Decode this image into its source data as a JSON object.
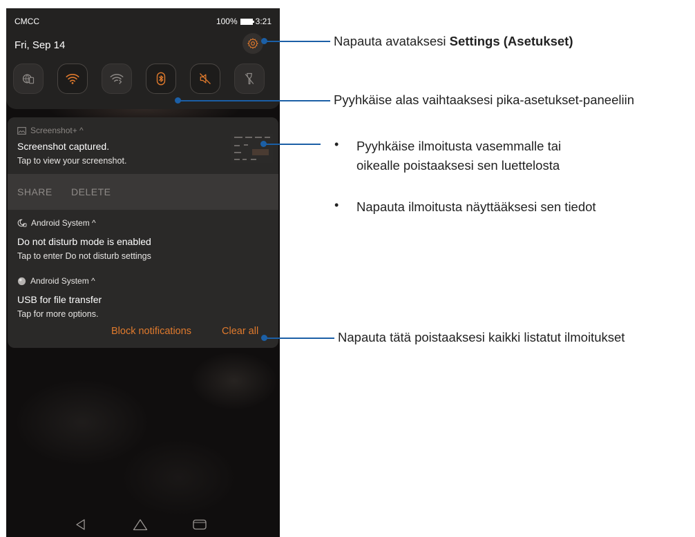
{
  "status_bar": {
    "carrier": "CMCC",
    "battery": "100%",
    "time": "3:21"
  },
  "quick_settings": {
    "date": "Fri, Sep 14",
    "tiles": [
      {
        "icon": "globe-sim-icon",
        "on": false
      },
      {
        "icon": "wifi-icon",
        "on": true
      },
      {
        "icon": "wifi-calling-icon",
        "on": false
      },
      {
        "icon": "bluetooth-icon",
        "on": true
      },
      {
        "icon": "mute-icon",
        "on": true
      },
      {
        "icon": "flashlight-off-icon",
        "on": false
      }
    ]
  },
  "notifications": {
    "screenshot": {
      "app": "Screenshot+ ^",
      "title": "Screenshot captured.",
      "text": "Tap to view your screenshot.",
      "actions": [
        "SHARE",
        "DELETE"
      ]
    },
    "dnd": {
      "app": "Android System ^",
      "title": "Do not disturb mode is enabled",
      "text": "Tap to enter Do not disturb settings"
    },
    "usb": {
      "app": "Android System ^",
      "title": "USB for file transfer",
      "text": "Tap for more options."
    },
    "footer": {
      "block_label": "Block notifications",
      "clear_label": "Clear all"
    }
  },
  "annotations": {
    "settings": {
      "prefix": "Napauta avataksesi ",
      "bold": "Settings (Asetukset)"
    },
    "swipe_down": "Pyyhkäise alas vaihtaaksesi pika-asetukset-paneeliin",
    "bullet_1_line_1": "Pyyhkäise ilmoitusta vasemmalle tai",
    "bullet_1_line_2": "oikealle poistaaksesi sen luettelosta",
    "bullet_2": "Napauta ilmoitusta näyttääksesi sen tiedot",
    "clear_all": "Napauta tätä poistaaksesi kaikki listatut ilmoitukset"
  },
  "colors": {
    "accent": "#e07a2d",
    "callout": "#1b5fa6"
  }
}
